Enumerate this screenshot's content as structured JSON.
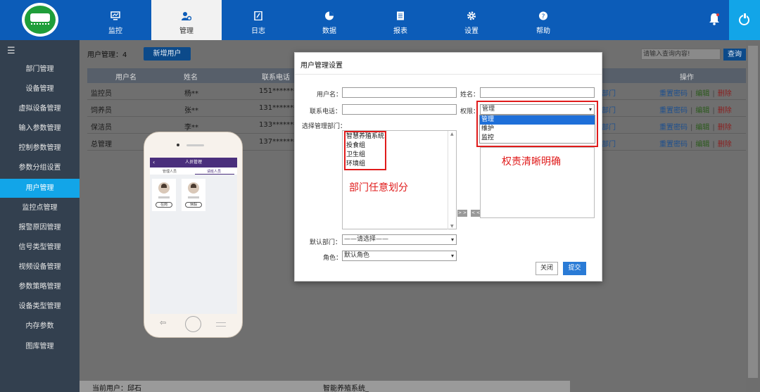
{
  "header": {
    "nav": [
      {
        "label": "监控",
        "icon": "monitor-icon"
      },
      {
        "label": "管理",
        "icon": "user-gear-icon"
      },
      {
        "label": "日志",
        "icon": "log-icon"
      },
      {
        "label": "数据",
        "icon": "pie-chart-icon"
      },
      {
        "label": "报表",
        "icon": "report-icon"
      },
      {
        "label": "设置",
        "icon": "gear-icon"
      },
      {
        "label": "帮助",
        "icon": "help-icon"
      }
    ],
    "active_nav": "管理",
    "colors": {
      "bar": "#0c5cb8",
      "power": "#12a5e8"
    }
  },
  "sidebar": {
    "items": [
      "部门管理",
      "设备管理",
      "虚拟设备管理",
      "输入参数管理",
      "控制参数管理",
      "参数分组设置",
      "用户管理",
      "监控点管理",
      "报警原因管理",
      "信号类型管理",
      "视频设备管理",
      "参数策略管理",
      "设备类型管理",
      "内存参数",
      "图库管理"
    ],
    "active": "用户管理"
  },
  "toolbar": {
    "count_label": "用户管理：4",
    "add_button": "新增用户",
    "search_placeholder": "请输入查询内容!",
    "search_button": "查询"
  },
  "table": {
    "headers": [
      "用户名",
      "姓名",
      "联系电话",
      "操作"
    ],
    "rows": [
      {
        "username": "监控员",
        "name": "杨**",
        "phone": "151********",
        "dept": "部门"
      },
      {
        "username": "饲养员",
        "name": "张**",
        "phone": "131********",
        "dept": "部门"
      },
      {
        "username": "保洁员",
        "name": "李**",
        "phone": "133********",
        "dept": "部门"
      },
      {
        "username": "总管理",
        "name": "",
        "phone": "137********",
        "dept": "部门"
      }
    ],
    "ops": {
      "reset": "重置密码",
      "edit": "编辑",
      "delete": "删除"
    }
  },
  "status": {
    "user": "当前用户：邱石",
    "system": "智能养殖系统_"
  },
  "phone": {
    "title": "人员管理",
    "tabs": [
      "管理人员",
      "请班人员"
    ],
    "cards": [
      {
        "status": "在岗"
      },
      {
        "status": "休假"
      }
    ]
  },
  "modal": {
    "title": "用户管理设置",
    "labels": {
      "username": "用户名：",
      "name": "姓名：",
      "phone": "联系电话：",
      "permission": "权限：",
      "select_dept": "选择管理部门：",
      "default_dept": "默认部门：",
      "role": "角色："
    },
    "permission_selected": "管理",
    "permission_options": [
      "管理",
      "维护",
      "监控"
    ],
    "departments": [
      "智慧养殖系统",
      "投食组",
      "卫生组",
      "环境组"
    ],
    "annot_dept": "部门任意划分",
    "annot_perm": "权责清晰明确",
    "move_right": "> >",
    "move_left": "< <",
    "default_dept_value": "——请选择——",
    "role_value": "默认角色",
    "close": "关闭",
    "submit": "提交"
  }
}
